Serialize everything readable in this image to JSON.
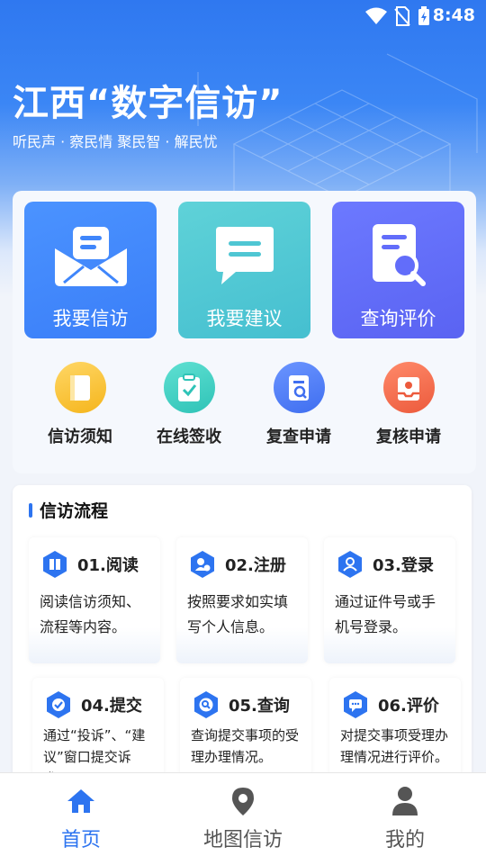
{
  "status_bar": {
    "time": "8:48"
  },
  "header": {
    "title": "江西“数字信访”",
    "subtitle": "听民声 · 察民情 聚民智 · 解民忧"
  },
  "main_actions": [
    {
      "label": "我要信访",
      "icon": "envelope-icon",
      "color": "#3f86fb"
    },
    {
      "label": "我要建议",
      "icon": "chat-icon",
      "color": "#4fc6d3"
    },
    {
      "label": "查询评价",
      "icon": "document-search-icon",
      "color": "#626dfa"
    }
  ],
  "quick_actions": [
    {
      "label": "信访须知",
      "icon": "book-icon",
      "color": "#f9c22e"
    },
    {
      "label": "在线签收",
      "icon": "clipboard-check-icon",
      "color": "#3ccbc0"
    },
    {
      "label": "复查申请",
      "icon": "doc-search-icon",
      "color": "#4a78f2"
    },
    {
      "label": "复核申请",
      "icon": "inbox-person-icon",
      "color": "#f0664a"
    }
  ],
  "process": {
    "title": "信访流程",
    "steps": [
      {
        "title": "01.阅读",
        "desc": "阅读信访须知、流程等内容。",
        "icon": "book-open-icon"
      },
      {
        "title": "02.注册",
        "desc": "按照要求如实填写个人信息。",
        "icon": "user-add-icon"
      },
      {
        "title": "03.登录",
        "desc": "通过证件号或手机号登录。",
        "icon": "user-icon"
      },
      {
        "title": "04.提交",
        "desc": "通过“投诉”、“建议”窗口提交诉求。",
        "icon": "check-icon"
      },
      {
        "title": "05.查询",
        "desc": "查询提交事项的受理办理情况。",
        "icon": "search-icon"
      },
      {
        "title": "06.评价",
        "desc": "对提交事项受理办理情况进行评价。",
        "icon": "comment-icon"
      }
    ]
  },
  "tabs": [
    {
      "label": "首页",
      "icon": "home-icon",
      "active": true
    },
    {
      "label": "地图信访",
      "icon": "location-pin-icon",
      "active": false
    },
    {
      "label": "我的",
      "icon": "person-icon",
      "active": false
    }
  ],
  "colors": {
    "accent": "#2d74f0",
    "hero_top": "#2f78f0"
  }
}
